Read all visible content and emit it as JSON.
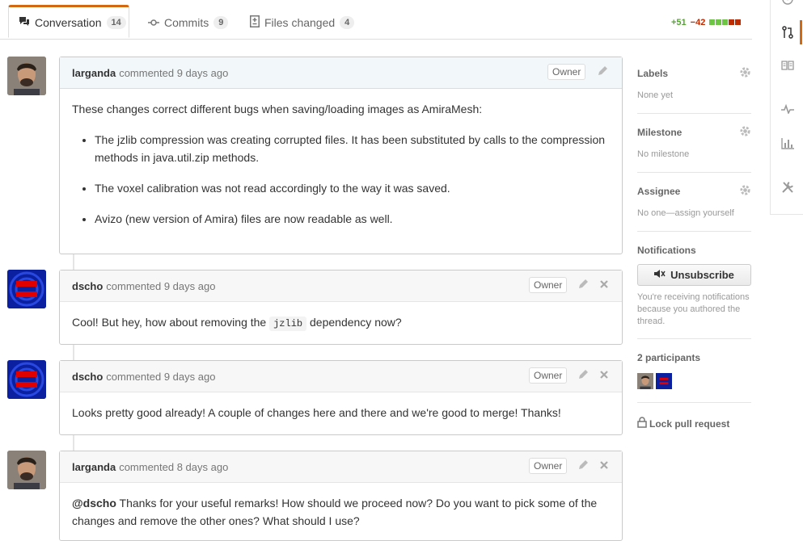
{
  "tabs": [
    {
      "label": "Conversation",
      "count": "14",
      "icon": "comment-discussion-icon"
    },
    {
      "label": "Commits",
      "count": "9",
      "icon": "commit-icon"
    },
    {
      "label": "Files changed",
      "count": "4",
      "icon": "file-diff-icon"
    }
  ],
  "diffstat": {
    "additions": "+51",
    "deletions": "−42"
  },
  "comments": [
    {
      "author": "larganda",
      "meta": "commented 9 days ago",
      "badge": "Owner",
      "intro": "These changes correct different bugs when saving/loading images as AmiraMesh:",
      "bullets": [
        "The jzlib compression was creating corrupted files. It has been substituted by calls to the compression methods in java.util.zip methods.",
        "The voxel calibration was not read accordingly to the way it was saved.",
        "Avizo (new version of Amira) files are now readable as well."
      ]
    },
    {
      "author": "dscho",
      "meta": "commented 9 days ago",
      "badge": "Owner",
      "text_before": "Cool! But hey, how about removing the ",
      "code": "jzlib",
      "text_after": " dependency now?"
    },
    {
      "author": "dscho",
      "meta": "commented 9 days ago",
      "badge": "Owner",
      "text": "Looks pretty good already! A couple of changes here and there and we're good to merge! Thanks!"
    },
    {
      "author": "larganda",
      "meta": "commented 8 days ago",
      "badge": "Owner",
      "mention": "@dscho",
      "text": " Thanks for your useful remarks! How should we proceed now? Do you want to pick some of the changes and remove the other ones? What should I use?"
    }
  ],
  "sidebar": {
    "labels": {
      "title": "Labels",
      "value": "None yet"
    },
    "milestone": {
      "title": "Milestone",
      "value": "No milestone"
    },
    "assignee": {
      "title": "Assignee",
      "value": "No one—assign yourself"
    },
    "notifications": {
      "title": "Notifications",
      "button": "Unsubscribe",
      "note": "You're receiving notifications because you authored the thread."
    },
    "participants": {
      "title": "2 participants"
    },
    "lock": "Lock pull request"
  },
  "colors": {
    "accent": "#d26911",
    "add": "#55a532",
    "del": "#bd2c00",
    "dscho_bg": "#0a20a0",
    "dscho_mark": "#e00000"
  }
}
